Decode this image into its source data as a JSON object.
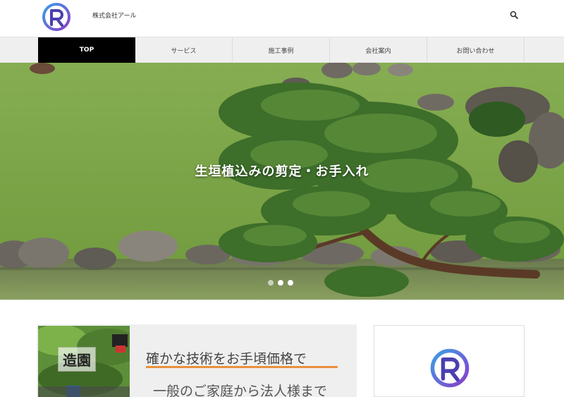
{
  "header": {
    "company_name": "株式会社アール",
    "logo_icon": "r-logo-icon",
    "search_icon": "search-icon"
  },
  "nav": {
    "items": [
      {
        "label": "TOP",
        "active": true
      },
      {
        "label": "サービス",
        "active": false
      },
      {
        "label": "施工事例",
        "active": false
      },
      {
        "label": "会社案内",
        "active": false
      },
      {
        "label": "お問い合わせ",
        "active": false
      }
    ]
  },
  "hero": {
    "caption": "生垣植込みの剪定・お手入れ",
    "slides": 3,
    "active_slide": 2
  },
  "promo": {
    "image_label": "造園",
    "title": "確かな技術をお手頃価格で",
    "subtitle": "一般のご家庭から法人様まで"
  },
  "colors": {
    "nav_active_bg": "#000000",
    "nav_bg": "#efefef",
    "accent_underline": "#e8913c",
    "logo_blue": "#2a7fd4",
    "logo_purple": "#7a3ccf"
  }
}
